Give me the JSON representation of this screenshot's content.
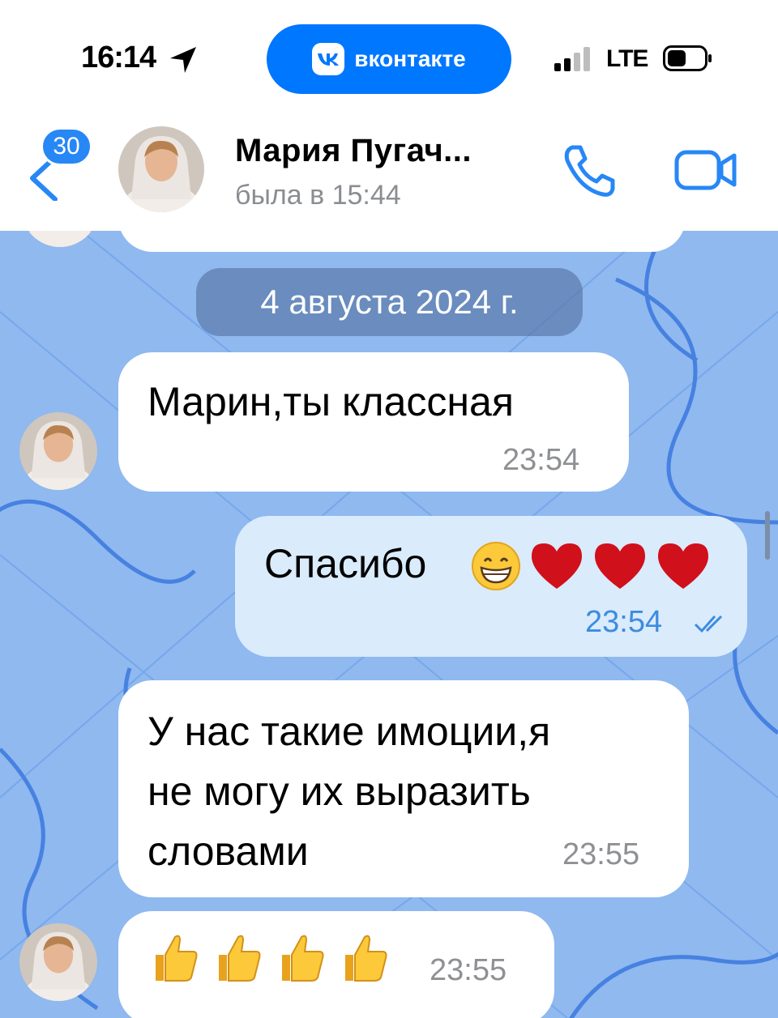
{
  "status_bar": {
    "time": "16:14",
    "app_pill": "вконтакте",
    "network": "LTE"
  },
  "header": {
    "badge_count": "30",
    "name": "Мария Пугач...",
    "status": "была в 15:44"
  },
  "chat": {
    "date_separator": "4 августа 2024 г.",
    "messages": [
      {
        "direction": "in",
        "text": "Марин,ты классная",
        "time": "23:54"
      },
      {
        "direction": "out",
        "text": "Спасибо",
        "emojis": "grin-heart-heart-heart",
        "time": "23:54",
        "read": true
      },
      {
        "direction": "in",
        "lines": [
          "У нас такие имоции,я",
          "не могу их выразить",
          "словами"
        ],
        "time": "23:55"
      },
      {
        "direction": "in",
        "emojis": "thumbs-up x4",
        "time": "23:55"
      }
    ]
  },
  "colors": {
    "accent": "#0077ff",
    "chat_bg": "#8fb9ef",
    "outgoing_bubble": "#daebfb",
    "incoming_bubble": "#ffffff"
  }
}
